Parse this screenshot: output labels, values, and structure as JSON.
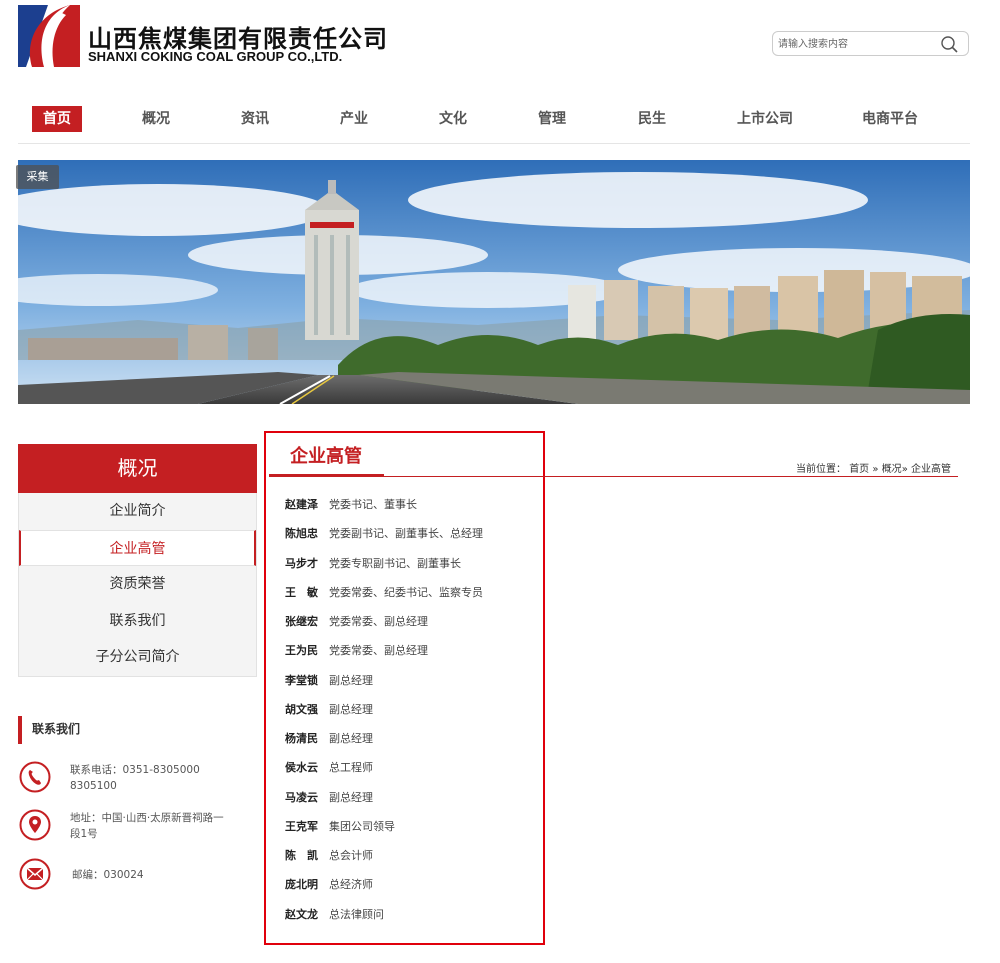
{
  "header": {
    "company_cn": "山西焦煤集团有限责任公司",
    "company_en": "SHANXI COKING COAL GROUP CO.,LTD.",
    "search_placeholder": "请输入搜索内容"
  },
  "nav": {
    "items": [
      {
        "label": "首页",
        "active": true
      },
      {
        "label": "概况"
      },
      {
        "label": "资讯"
      },
      {
        "label": "产业"
      },
      {
        "label": "文化"
      },
      {
        "label": "管理"
      },
      {
        "label": "民生"
      },
      {
        "label": "上市公司"
      },
      {
        "label": "电商平台"
      }
    ]
  },
  "banner": {
    "tag": "采集"
  },
  "sidebar": {
    "title": "概况",
    "items": [
      {
        "label": "企业简介"
      },
      {
        "label": "企业高管",
        "active": true
      },
      {
        "label": "资质荣誉"
      },
      {
        "label": "联系我们"
      },
      {
        "label": "子分公司简介"
      }
    ],
    "contact": {
      "title": "联系我们",
      "phone": "联系电话：0351-8305000",
      "phone2": "8305100",
      "address": "地址：中国·山西·太原新晋祠路一",
      "address2": "段1号",
      "postcode": "邮编：030024"
    }
  },
  "main": {
    "title": "企业高管",
    "breadcrumb": {
      "prefix": "当前位置：",
      "home": "首页",
      "sep1": "»",
      "section": "概况",
      "sep2": "»",
      "current": "企业高管"
    },
    "executives": [
      {
        "name": "赵建泽",
        "role": "党委书记、董事长"
      },
      {
        "name": "陈旭忠",
        "role": "党委副书记、副董事长、总经理"
      },
      {
        "name": "马步才",
        "role": "党委专职副书记、副董事长"
      },
      {
        "name": "王　敏",
        "role": "党委常委、纪委书记、监察专员"
      },
      {
        "name": "张继宏",
        "role": "党委常委、副总经理"
      },
      {
        "name": "王为民",
        "role": "党委常委、副总经理"
      },
      {
        "name": "李堂锁",
        "role": "副总经理"
      },
      {
        "name": "胡文强",
        "role": "副总经理"
      },
      {
        "name": "杨清民",
        "role": "副总经理"
      },
      {
        "name": "侯水云",
        "role": "总工程师"
      },
      {
        "name": "马凌云",
        "role": "副总经理"
      },
      {
        "name": "王克军",
        "role": "集团公司领导"
      },
      {
        "name": "陈　凯",
        "role": "总会计师"
      },
      {
        "name": "庞北明",
        "role": "总经济师"
      },
      {
        "name": "赵文龙",
        "role": "总法律顾问"
      }
    ]
  },
  "colors": {
    "brand_red": "#c41f22",
    "logo_blue": "#1c3f8f",
    "highlight_box": "#e0000c"
  }
}
